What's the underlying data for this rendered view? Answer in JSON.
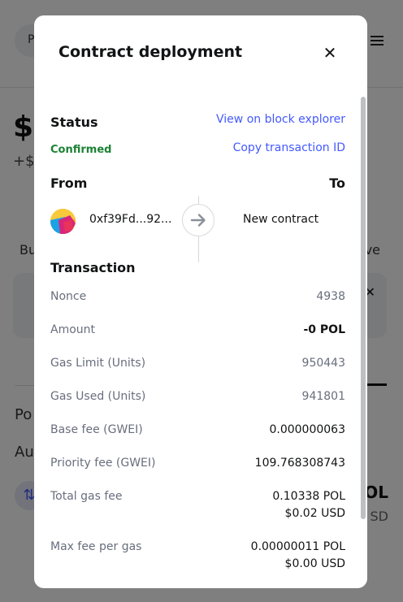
{
  "background": {
    "account_pill": "P",
    "balance_fragment": "$(",
    "change_fragment": "+$(",
    "buy_fragment": "Bu",
    "receive_fragment": "ve",
    "tokens_fragment": "Po",
    "aut_fragment": "Au",
    "pol_fragment": "OL",
    "usd_fragment": "SD"
  },
  "modal": {
    "title": "Contract deployment",
    "status": {
      "label": "Status",
      "value": "Confirmed",
      "view_explorer_link": "View on block explorer",
      "copy_tx_link": "Copy transaction ID"
    },
    "from_label": "From",
    "to_label": "To",
    "from_address": "0xf39Fd...92...",
    "to_value": "New contract",
    "transaction": {
      "heading": "Transaction",
      "rows": [
        {
          "label": "Nonce",
          "value": "4938"
        },
        {
          "label": "Amount",
          "value": "-0 POL"
        },
        {
          "label": "Gas Limit (Units)",
          "value": "950443"
        },
        {
          "label": "Gas Used (Units)",
          "value": "941801"
        },
        {
          "label": "Base fee (GWEI)",
          "value": "0.000000063"
        },
        {
          "label": "Priority fee (GWEI)",
          "value": "109.768308743"
        },
        {
          "label": "Total gas fee",
          "value": "0.10338 POL",
          "value2": "$0.02 USD"
        },
        {
          "label": "Max fee per gas",
          "value": "0.00000011 POL",
          "value2": "$0.00 USD"
        }
      ]
    }
  },
  "colors": {
    "link": "#4459ff",
    "confirmed": "#1c8234",
    "muted_text": "#686e7d"
  }
}
